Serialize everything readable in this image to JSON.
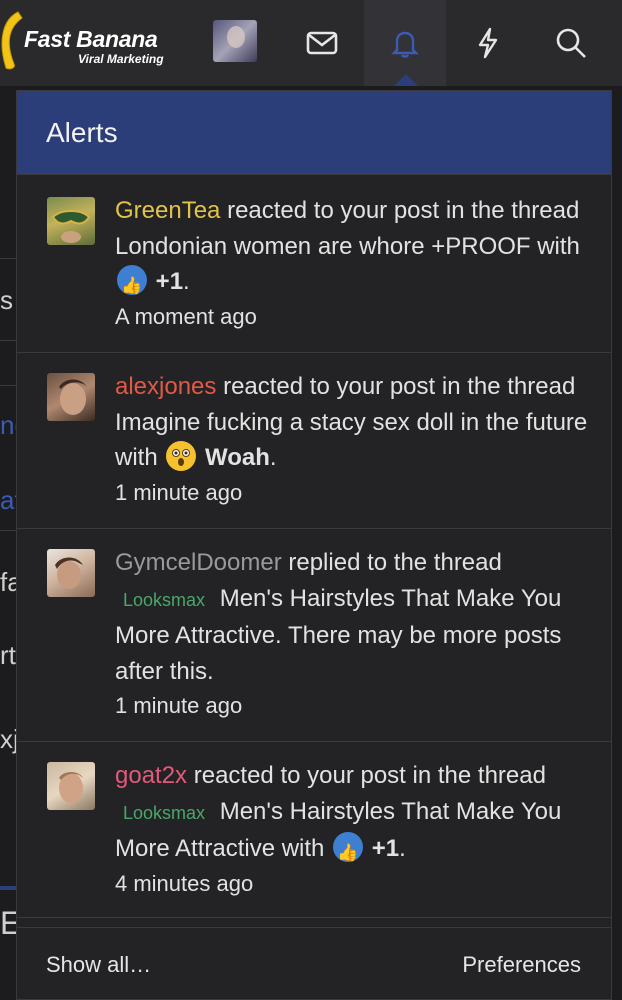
{
  "brand": {
    "title": "Fast Banana",
    "subtitle": "Viral Marketing",
    "banana_color": "#f2c318"
  },
  "nav": {
    "icons": [
      "envelope-icon",
      "bell-icon",
      "bolt-icon",
      "search-icon"
    ],
    "active": "bell-icon",
    "accent": "#2c3e7a"
  },
  "background_fragments": [
    "s a",
    "ne",
    "at",
    "fa",
    "rt",
    "xjo",
    "E"
  ],
  "alerts_panel": {
    "title": "Alerts",
    "items": [
      {
        "user": "GreenTea",
        "user_color": "#e0c44a",
        "text_a": " reacted to your post in the thread Londonian women are whore +PROOF with ",
        "reaction": "+1",
        "reaction_icon": "thumbs-up-icon",
        "time": "A moment ago"
      },
      {
        "user": "alexjones",
        "user_color": "#e05a45",
        "text_a": " reacted to your post in the thread Imagine fucking a stacy sex doll in the future with ",
        "reaction": "Woah",
        "reaction_icon": "wow-face-icon",
        "time": "1 minute ago"
      },
      {
        "user": "GymcelDoomer",
        "user_color": "#9a9a9a",
        "text_a": " replied to the thread ",
        "tag": "Looksmax",
        "text_b": " Men's Hairstyles That Make You More Attractive. There may be more posts after this.",
        "time": "1 minute ago"
      },
      {
        "user": "goat2x",
        "user_color": "#e05a7a",
        "text_a": " reacted to your post in the thread ",
        "tag": "Looksmax",
        "text_b": " Men's Hairstyles That Make You More Attractive with ",
        "reaction": "+1",
        "reaction_icon": "thumbs-up-icon",
        "time": "4 minutes ago"
      }
    ],
    "footer": {
      "show_all": "Show all…",
      "preferences": "Preferences"
    }
  }
}
